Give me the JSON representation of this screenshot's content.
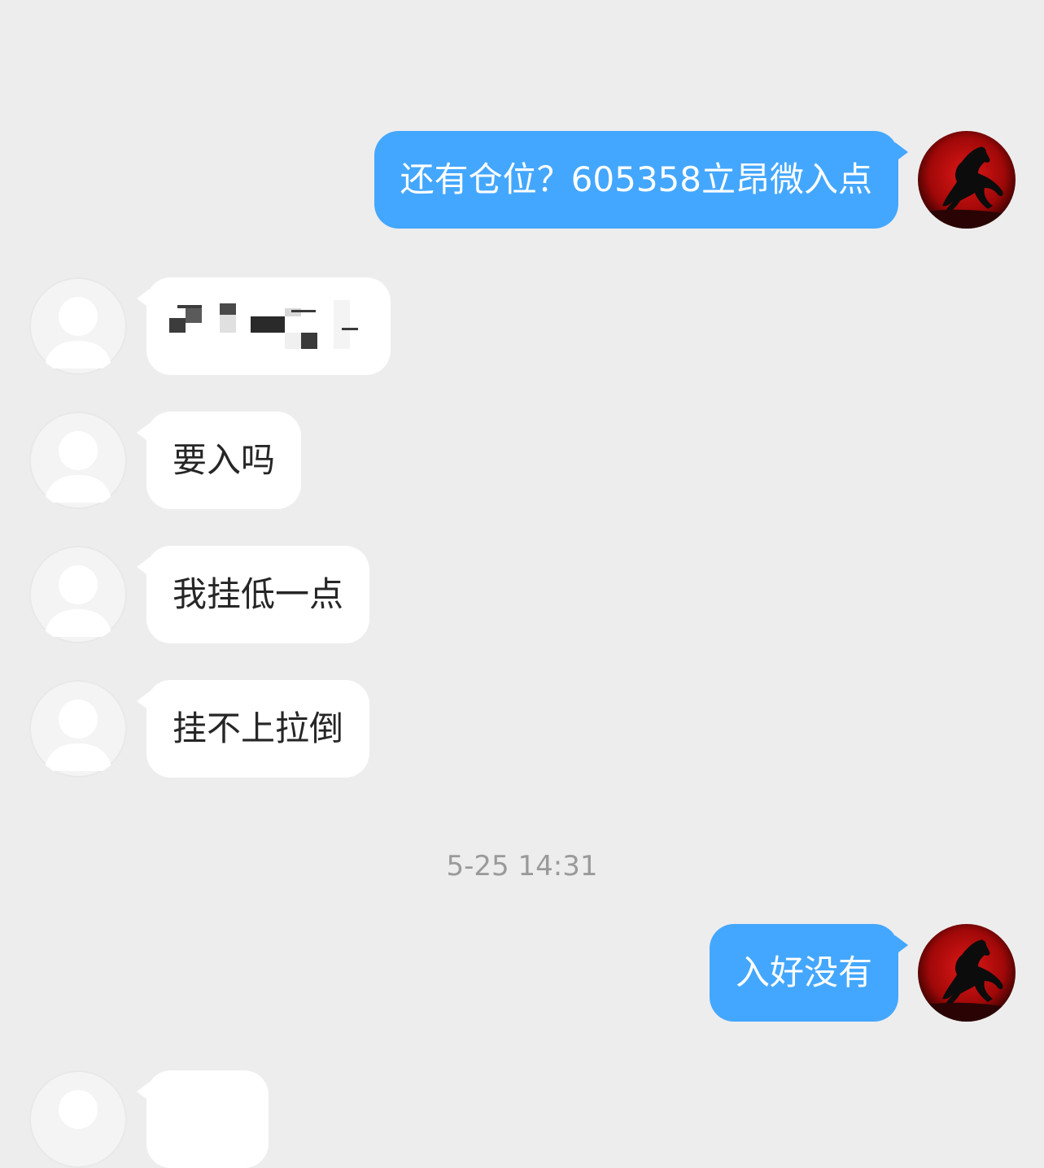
{
  "conversation": {
    "messages": [
      {
        "direction": "outgoing",
        "text": "还有仓位？605358立昂微入点"
      },
      {
        "direction": "incoming",
        "text": "",
        "redacted": true
      },
      {
        "direction": "incoming",
        "text": "要入吗"
      },
      {
        "direction": "incoming",
        "text": "我挂低一点"
      },
      {
        "direction": "incoming",
        "text": "挂不上拉倒"
      },
      {
        "direction": "outgoing",
        "text": "入好没有"
      }
    ],
    "timestamp": "5-25 14:31"
  },
  "avatars": {
    "self": "red-moon-horse-avatar",
    "contact": "default-person-avatar"
  },
  "colors": {
    "background": "#ededed",
    "outgoing_bubble": "#44a7ff",
    "incoming_bubble": "#ffffff",
    "timestamp_text": "#9a9a9a"
  }
}
